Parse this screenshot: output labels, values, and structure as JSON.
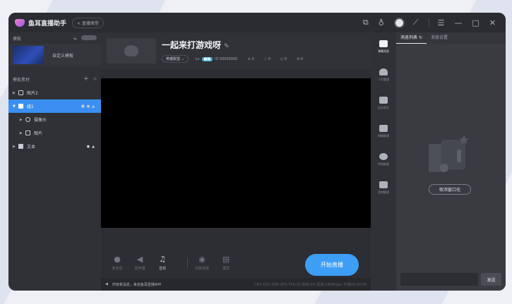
{
  "app": {
    "title": "鱼耳直播助手",
    "back_label": "< 直播类型"
  },
  "titlebar_icons": [
    "screen-share-icon",
    "trophy-icon",
    "avatar",
    "chart-icon",
    "menu-icon",
    "minimize-icon",
    "maximize-icon",
    "close-icon"
  ],
  "left": {
    "template_section": "模板",
    "template_item": "自定义模板",
    "material_section": "模板素材",
    "tree": [
      {
        "label": "图片2",
        "level": 0,
        "selected": false
      },
      {
        "label": "组1",
        "level": 0,
        "selected": true
      },
      {
        "label": "摄像头",
        "level": 1,
        "selected": false
      },
      {
        "label": "图片",
        "level": 1,
        "selected": false
      },
      {
        "label": "文本",
        "level": 0,
        "selected": false
      }
    ]
  },
  "room": {
    "title": "一起来打游戏呀",
    "category": "英雄联盟",
    "level_prefix": "Lv",
    "id_label": "ID 00000000",
    "stats": [
      "0",
      "0",
      "0",
      "0"
    ]
  },
  "controls": {
    "mic": "麦克风",
    "speaker": "扬声器",
    "music": "音效",
    "scene": "切换场景",
    "record": "录屏",
    "start_live": "开始直播"
  },
  "status": {
    "message": "你有新消息，来自鱼耳直播APP",
    "perf": "CPU:10%  内存:20%  FPS:30  丢帧:0%  码率:2456kbps  开播00:00:00"
  },
  "rail": [
    "弹幕消息",
    "人员管理",
    "自动发言",
    "弹幕助理",
    "特效能量",
    "音频管理"
  ],
  "chat": {
    "tab_messages": "消息列表",
    "tab_settings": "消息设置",
    "cancel_window": "取消窗口化",
    "input_placeholder": "",
    "send": "发送"
  },
  "colors": {
    "accent": "#3c9ef5",
    "selected_row": "#3b8ff2",
    "lv_badge": "#3fb8e8"
  }
}
